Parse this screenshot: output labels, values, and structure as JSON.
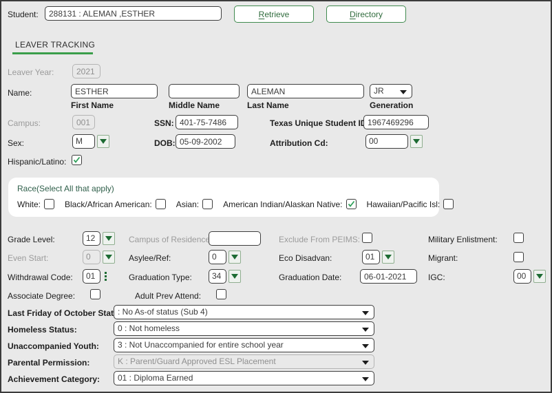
{
  "student_bar": {
    "label": "Student:",
    "value": "288131 : ALEMAN ,ESTHER",
    "retrieve_button": {
      "accesskey": "R",
      "rest": "etrieve"
    },
    "directory_button": {
      "accesskey": "D",
      "rest": "irectory"
    }
  },
  "tab": {
    "label": "LEAVER TRACKING",
    "underline_color": "#3a9e4a"
  },
  "leaver_year": {
    "label": "Leaver Year:",
    "value": "2021"
  },
  "name_row": {
    "label": "Name:",
    "first": {
      "value": "ESTHER",
      "caption": "First Name"
    },
    "middle": {
      "value": "",
      "caption": "Middle Name"
    },
    "last": {
      "value": "ALEMAN",
      "caption": "Last Name"
    },
    "generation": {
      "value": "JR",
      "caption": "Generation"
    }
  },
  "campus": {
    "label": "Campus:",
    "value": "001"
  },
  "ssn": {
    "label": "SSN:",
    "value": "401-75-7486"
  },
  "texas_id": {
    "label": "Texas Unique Student ID:",
    "value": "1967469296"
  },
  "sex": {
    "label": "Sex:",
    "value": "M"
  },
  "dob": {
    "label": "DOB:",
    "value": "05-09-2002"
  },
  "attribution_cd": {
    "label": "Attribution Cd:",
    "value": "00"
  },
  "hispanic": {
    "label": "Hispanic/Latino:",
    "checked": true
  },
  "race": {
    "legend": "Race(Select All that apply)",
    "items": [
      {
        "label": "White:",
        "checked": false
      },
      {
        "label": "Black/African American:",
        "checked": false
      },
      {
        "label": "Asian:",
        "checked": false
      },
      {
        "label": "American Indian/Alaskan Native:",
        "checked": true
      },
      {
        "label": "Hawaiian/Pacific Isl:",
        "checked": false
      }
    ]
  },
  "grade_level": {
    "label": "Grade Level:",
    "value": "12"
  },
  "campus_residence": {
    "label": "Campus of Residence:",
    "value": ""
  },
  "exclude_peims": {
    "label": "Exclude From PEIMS:",
    "checked": false
  },
  "military": {
    "label": "Military Enlistment:",
    "checked": false
  },
  "even_start": {
    "label": "Even Start:",
    "value": "0"
  },
  "asylee_ref": {
    "label": "Asylee/Ref:",
    "value": "0"
  },
  "eco_disadvan": {
    "label": "Eco Disadvan:",
    "value": "01"
  },
  "migrant": {
    "label": "Migrant:",
    "checked": false
  },
  "withdrawal_code": {
    "label": "Withdrawal Code:",
    "value": "01"
  },
  "graduation_type": {
    "label": "Graduation Type:",
    "value": "34"
  },
  "graduation_date": {
    "label": "Graduation Date:",
    "value": "06-01-2021"
  },
  "igc": {
    "label": "IGC:",
    "value": "00"
  },
  "associate_degree": {
    "label": "Associate Degree:",
    "checked": false
  },
  "adult_prev_attend": {
    "label": "Adult Prev Attend:",
    "checked": false
  },
  "selects": [
    {
      "label": "Last Friday of October Status:",
      "value": ": No As-of status (Sub 4)",
      "dim": false
    },
    {
      "label": "Homeless Status:",
      "value": "0 : Not homeless",
      "dim": false
    },
    {
      "label": "Unaccompanied Youth:",
      "value": "3 : Not Unaccompanied for entire school year",
      "dim": false
    },
    {
      "label": "Parental Permission:",
      "value": "K : Parent/Guard Approved ESL Placement",
      "dim": true
    },
    {
      "label": "Achievement Category:",
      "value": "01 : Diploma Earned",
      "dim": false
    }
  ]
}
